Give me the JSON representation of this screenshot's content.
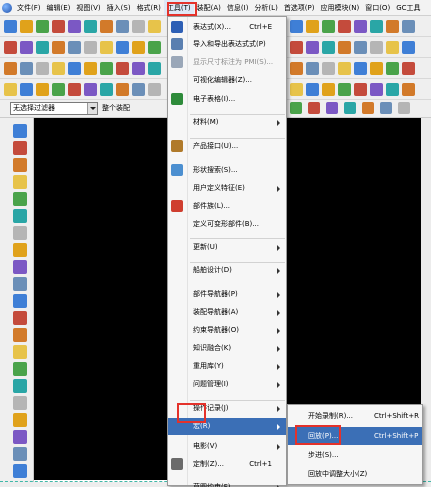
{
  "menubar": {
    "items": [
      "文件(F)",
      "编辑(E)",
      "视图(V)",
      "插入(S)",
      "格式(R)",
      "工具(T)",
      "装配(A)",
      "信息(I)",
      "分析(L)",
      "首选项(P)",
      "应用模块(N)",
      "窗口(O)",
      "GC工具"
    ],
    "active_index": 5
  },
  "selection_bar": {
    "filter_value": "无选择过滤器",
    "assembly_value": "整个装配"
  },
  "tools_menu": {
    "items": [
      {
        "label": "表达式(X)...",
        "shortcut": "Ctrl+E",
        "icon": "expression-icon",
        "color": "#2d5fb5"
      },
      {
        "label": "导入和导出表达式式(P)",
        "icon": "import-export-icon",
        "color": "#5a7fb0"
      },
      {
        "label": "显示尺寸标注为 PMI(S)...",
        "icon": "pmi-icon",
        "color": "#9aa7b8",
        "disabled": true
      },
      {
        "label": "可视化编辑器(Z)...",
        "icon": "blank-icon"
      },
      {
        "label": "电子表格(I)...",
        "icon": "spreadsheet-icon",
        "color": "#2e8b3a"
      },
      {
        "label": "材料(M)",
        "submenu": true,
        "icon": "blank-icon"
      },
      {
        "label": "产品接口(U)...",
        "icon": "product-interface-icon",
        "color": "#b07a2a"
      },
      {
        "label": "形状搜索(S)...",
        "icon": "shape-search-icon",
        "color": "#4c8fd0"
      },
      {
        "label": "用户定义特征(E)",
        "submenu": true,
        "icon": "blank-icon"
      },
      {
        "label": "部件族(L)...",
        "icon": "part-family-icon",
        "color": "#cf3e2f"
      },
      {
        "label": "定义可变形部件(B)...",
        "icon": "blank-icon"
      },
      {
        "label": "更新(U)",
        "submenu": true,
        "icon": "blank-icon"
      },
      {
        "label": "船舶设计(D)",
        "submenu": true,
        "icon": "blank-icon"
      },
      {
        "label": "部件导航器(P)",
        "submenu": true,
        "icon": "blank-icon"
      },
      {
        "label": "装配导航器(A)",
        "submenu": true,
        "icon": "blank-icon"
      },
      {
        "label": "约束导航器(O)",
        "submenu": true,
        "icon": "blank-icon"
      },
      {
        "label": "知识融合(K)",
        "submenu": true,
        "icon": "blank-icon"
      },
      {
        "label": "重用库(Y)",
        "submenu": true,
        "icon": "blank-icon"
      },
      {
        "label": "问题管理(I)",
        "submenu": true,
        "icon": "blank-icon"
      },
      {
        "label": "操作记录(J)",
        "submenu": true,
        "icon": "blank-icon"
      },
      {
        "label": "宏(R)",
        "submenu": true,
        "highlighted": true,
        "icon": "blank-icon"
      },
      {
        "label": "电影(V)",
        "submenu": true,
        "icon": "blank-icon"
      },
      {
        "label": "定制(Z)...",
        "shortcut": "Ctrl+1",
        "icon": "customize-icon",
        "color": "#6b6b6b"
      },
      {
        "label": "草图约束(F)",
        "submenu": true,
        "icon": "blank-icon"
      }
    ]
  },
  "macro_submenu": {
    "items": [
      {
        "label": "开始录制(R)...",
        "shortcut": "Ctrl+Shift+R"
      },
      {
        "label": "回放(P)...",
        "shortcut": "Ctrl+Shift+P",
        "highlighted": true
      },
      {
        "label": "步进(S)..."
      },
      {
        "label": "回放中调整大小(Z)"
      }
    ]
  },
  "colors": {
    "highlight": "#3b6fb6",
    "annotation": "#e4322b",
    "graphics_background": "#000000"
  }
}
